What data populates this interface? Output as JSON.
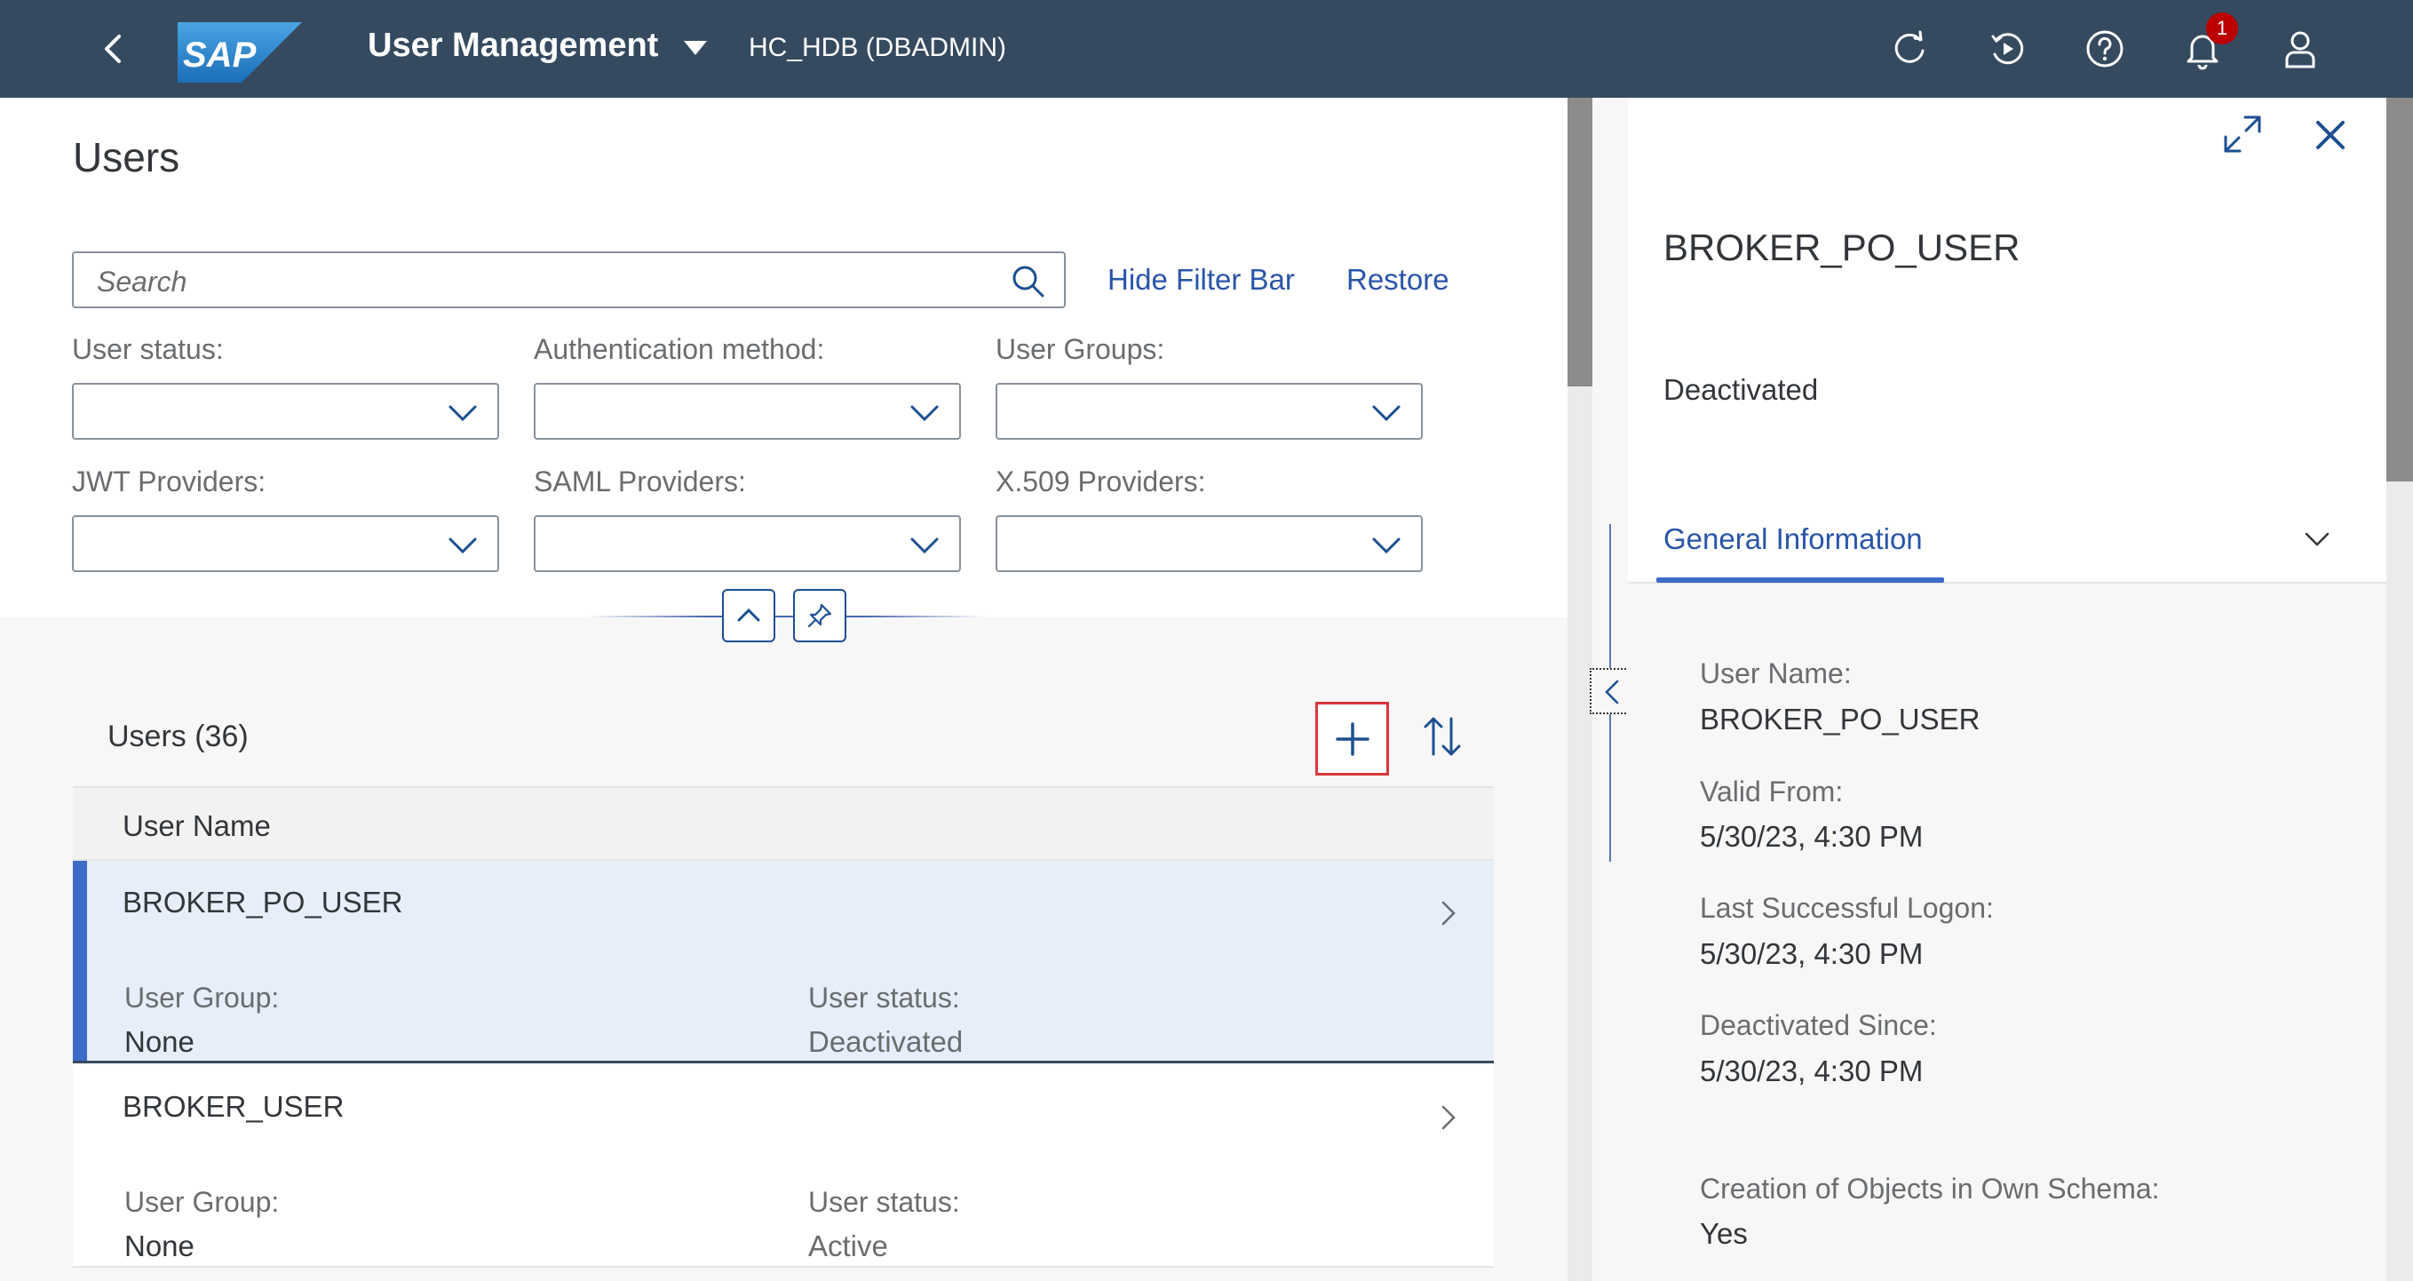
{
  "shell": {
    "title": "User Management",
    "system": "HC_HDB (DBADMIN)",
    "logo_text": "SAP",
    "notification_count": "1",
    "icons": [
      "back-icon",
      "refresh-icon",
      "replay-icon",
      "help-icon",
      "notification-icon",
      "user-icon"
    ]
  },
  "page": {
    "title": "Users",
    "search_placeholder": "Search",
    "hide_filter_bar": "Hide Filter Bar",
    "restore": "Restore"
  },
  "filters": [
    {
      "label": "User status:",
      "value": ""
    },
    {
      "label": "Authentication method:",
      "value": ""
    },
    {
      "label": "User Groups:",
      "value": ""
    },
    {
      "label": "JWT Providers:",
      "value": ""
    },
    {
      "label": "SAML Providers:",
      "value": ""
    },
    {
      "label": "X.509 Providers:",
      "value": ""
    }
  ],
  "table": {
    "title": "Users (36)",
    "column_header": "User Name",
    "rows": [
      {
        "name": "BROKER_PO_USER",
        "group_label": "User Group:",
        "group": "None",
        "status_label": "User status:",
        "status": "Deactivated",
        "selected": true
      },
      {
        "name": "BROKER_USER",
        "group_label": "User Group:",
        "group": "None",
        "status_label": "User status:",
        "status": "Active",
        "selected": false
      }
    ]
  },
  "detail": {
    "title": "BROKER_PO_USER",
    "status": "Deactivated",
    "tab": "General Information",
    "fields": [
      {
        "label": "User Name:",
        "value": "BROKER_PO_USER"
      },
      {
        "label": "Valid From:",
        "value": "5/30/23, 4:30 PM"
      },
      {
        "label": "Last Successful Logon:",
        "value": "5/30/23, 4:30 PM"
      },
      {
        "label": "Deactivated Since:",
        "value": "5/30/23, 4:30 PM"
      },
      {
        "label": "Creation of Objects in Own Schema:",
        "value": "Yes"
      }
    ]
  },
  "colors": {
    "shell_bg": "#354a5f",
    "link": "#2a55a8",
    "selection": "#e6eef9",
    "highlight_box": "#d9363e"
  }
}
